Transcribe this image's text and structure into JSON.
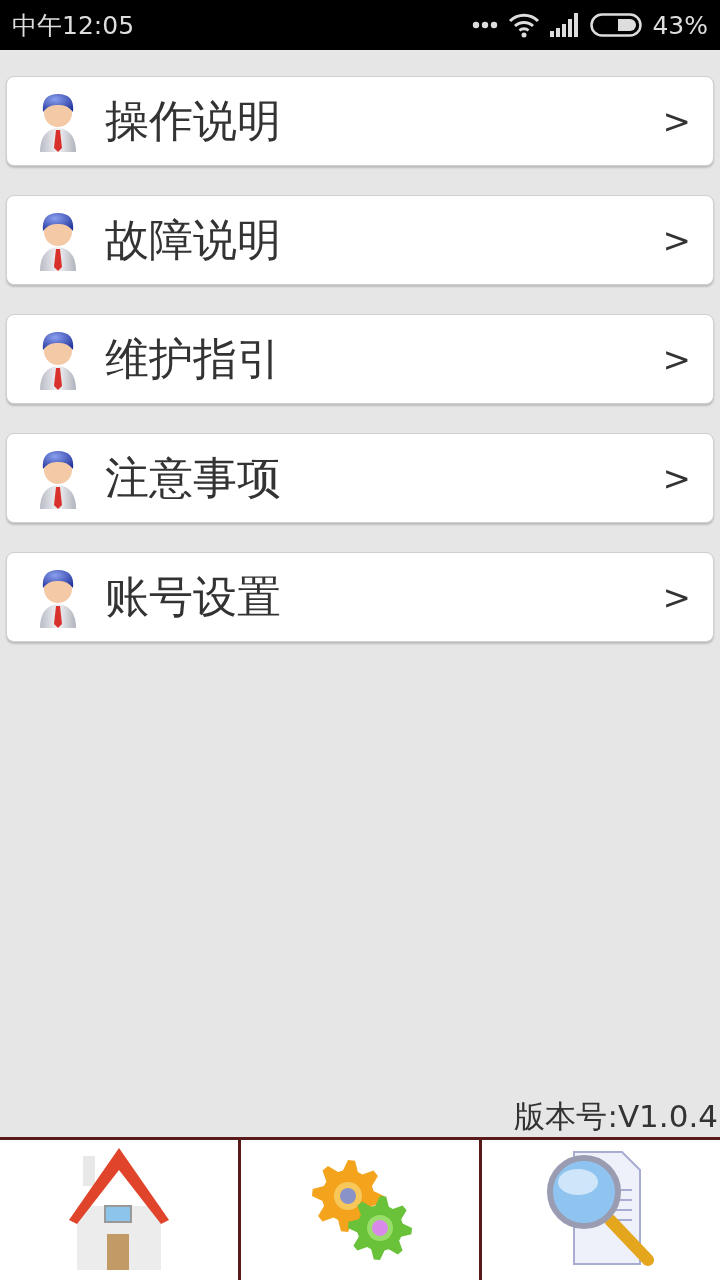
{
  "status_bar": {
    "time": "中午12:05",
    "battery": "43%"
  },
  "menu": [
    {
      "label": "操作说明",
      "arrow": ">"
    },
    {
      "label": "故障说明",
      "arrow": ">"
    },
    {
      "label": "维护指引",
      "arrow": ">"
    },
    {
      "label": "注意事项",
      "arrow": ">"
    },
    {
      "label": "账号设置",
      "arrow": ">"
    }
  ],
  "version": "版本号:V1.0.4"
}
